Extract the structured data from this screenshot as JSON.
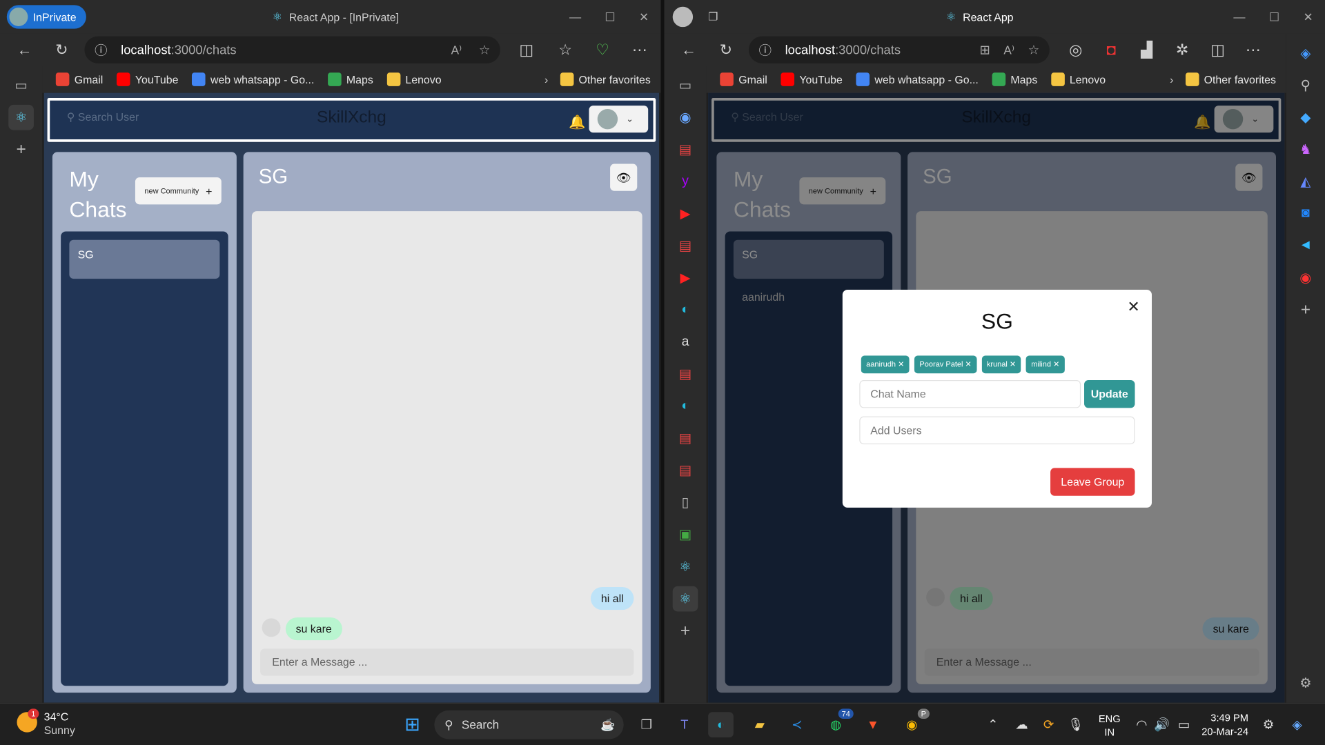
{
  "left_window": {
    "inprivate_label": "InPrivate",
    "title": "React App - [InPrivate]",
    "url_host": "localhost",
    "url_path": ":3000/chats"
  },
  "right_window": {
    "title": "React App",
    "url_host": "localhost",
    "url_path": ":3000/chats"
  },
  "favorites": [
    {
      "label": "Gmail",
      "icon": "gmail-icon",
      "color": "#ea4335"
    },
    {
      "label": "YouTube",
      "icon": "youtube-icon",
      "color": "#ff0000"
    },
    {
      "label": "web whatsapp - Go...",
      "icon": "google-icon",
      "color": "#4285f4"
    },
    {
      "label": "Maps",
      "icon": "maps-icon",
      "color": "#34a853"
    },
    {
      "label": "Lenovo",
      "icon": "folder-icon",
      "color": "#f4c542"
    }
  ],
  "other_favorites": "Other favorites",
  "app": {
    "search_placeholder": "Search User",
    "brand": "SkillXchg",
    "my_chats_line1": "My",
    "my_chats_line2": "Chats",
    "new_community": "new Community",
    "chat_list": [
      "SG",
      "aanirudh"
    ],
    "selected_chat": "SG",
    "messages": [
      {
        "text": "hi all",
        "side": "right"
      },
      {
        "text": "su kare",
        "side": "left"
      }
    ],
    "messages_right_view": [
      {
        "text": "hi all",
        "side": "left"
      },
      {
        "text": "su kare",
        "side": "right"
      }
    ],
    "message_placeholder": "Enter a Message ..."
  },
  "modal": {
    "title": "SG",
    "members": [
      "aanirudh",
      "Poorav Patel",
      "krunal",
      "milind"
    ],
    "chat_name_placeholder": "Chat Name",
    "update_label": "Update",
    "add_users_placeholder": "Add Users",
    "leave_label": "Leave Group"
  },
  "taskbar": {
    "weather_temp": "34°C",
    "weather_desc": "Sunny",
    "weather_badge": "1",
    "search_label": "Search",
    "whatsapp_badge": "74",
    "chrome_badge": "P",
    "lang_line1": "ENG",
    "lang_line2": "IN",
    "time": "3:49 PM",
    "date": "20-Mar-24"
  },
  "colors": {
    "accent_teal": "#319795",
    "danger": "#e53e3e",
    "app_header": "#1e3354"
  }
}
